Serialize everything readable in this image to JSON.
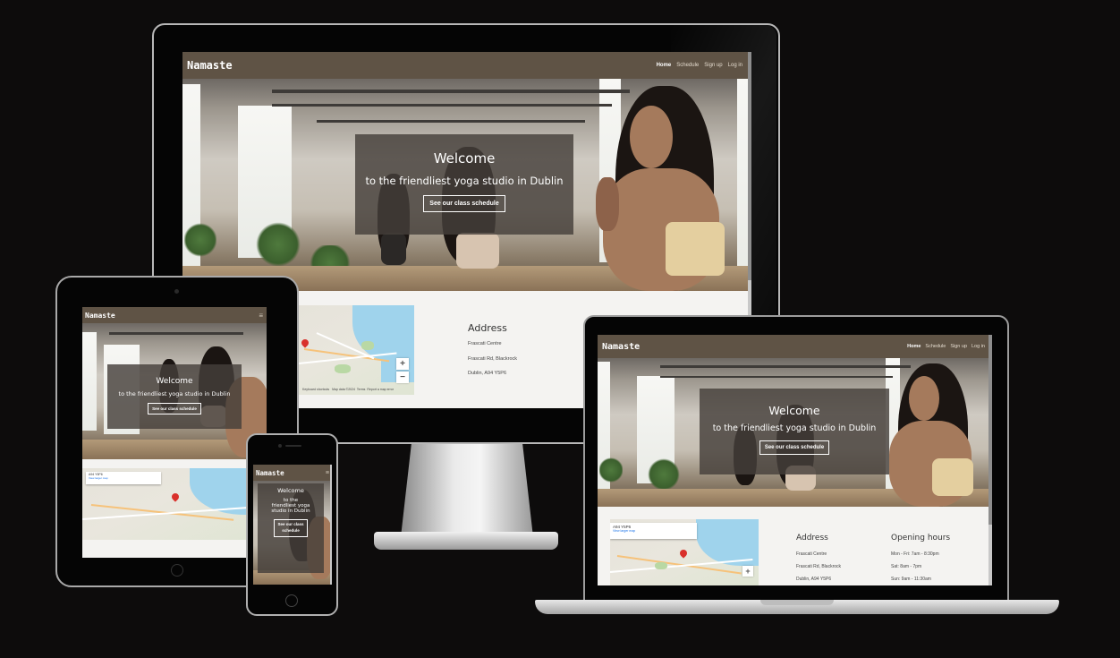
{
  "site": {
    "brand": "Namaste",
    "nav": [
      "Home",
      "Schedule",
      "Sign up",
      "Log in"
    ],
    "hero_title": "Welcome",
    "hero_subtitle": "to the friendliest yoga studio in Dublin",
    "hero_subtitle_lines": [
      "to the",
      "friendliest yoga",
      "studio in Dublin"
    ],
    "hero_button": "See our class schedule",
    "hero_button_lines": [
      "See our class",
      "schedule"
    ],
    "address_heading": "Address",
    "address_lines": [
      "Frascati Centre",
      "Frascati Rd, Blackrock",
      "Dublin, A94 Y5P6"
    ],
    "hours_heading": "Opening hours",
    "hours_lines": [
      "Mon - Fri: 7am - 8:30pm",
      "Sat: 8am - 7pm",
      "Sun: 9am - 11:30am"
    ]
  },
  "map": {
    "place": "A94 Y5P6",
    "view_larger": "View larger map",
    "zoom_in": "+",
    "zoom_out": "−",
    "footer": [
      "Keyboard shortcuts",
      "Map data ©2024",
      "Terms",
      "Report a map error"
    ]
  },
  "colors": {
    "background": "#0d0c0c",
    "navbar": "#5f5345",
    "overlay": "rgba(70,63,58,0.82)",
    "page": "#f4f3f1"
  },
  "icons": [
    "hamburger-menu-icon",
    "map-pin-icon"
  ]
}
